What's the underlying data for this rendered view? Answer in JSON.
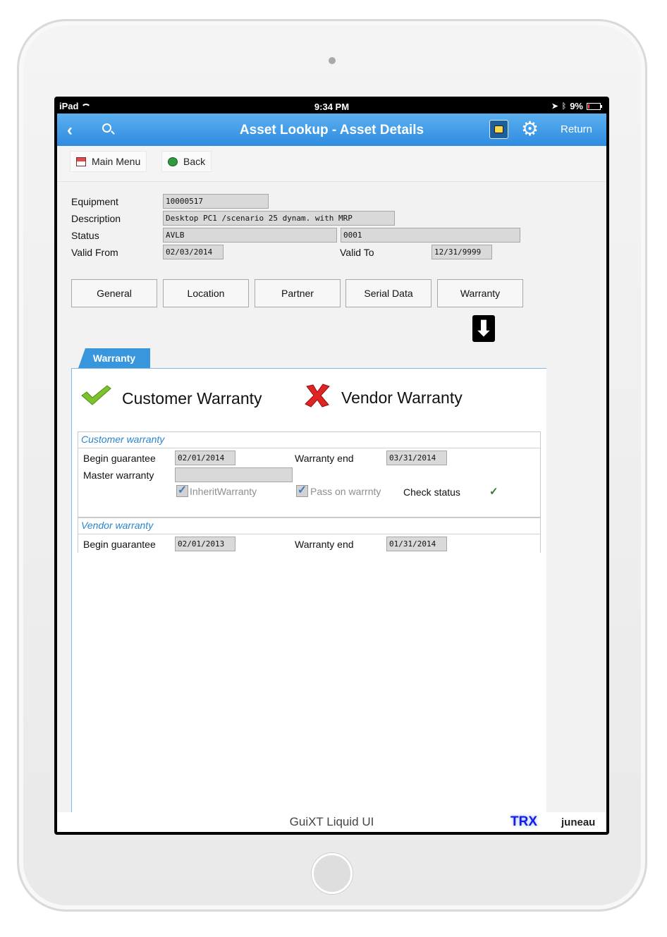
{
  "status_bar": {
    "device": "iPad",
    "time": "9:34 PM",
    "battery": "9%"
  },
  "nav": {
    "title": "Asset Lookup - Asset Details",
    "back_glyph": "‹",
    "return_label": "Return"
  },
  "toolbar": {
    "main_menu_label": "Main Menu",
    "back_label": "Back"
  },
  "header_fields": {
    "equipment_label": "Equipment",
    "equipment_value": "10000517",
    "description_label": "Description",
    "description_value": "Desktop PC1 /scenario 25 dynam. with MRP",
    "status_label": "Status",
    "status_value": "AVLB",
    "status_code": "0001",
    "valid_from_label": "Valid From",
    "valid_from_value": "02/03/2014",
    "valid_to_label": "Valid To",
    "valid_to_value": "12/31/9999"
  },
  "tabs": [
    "General",
    "Location",
    "Partner",
    "Serial Data",
    "Warranty"
  ],
  "active_tab_label": "Warranty",
  "warranty_status": {
    "customer_heading": "Customer Warranty",
    "vendor_heading": "Vendor Warranty"
  },
  "customer_group": {
    "title": "Customer warranty",
    "begin_label": "Begin guarantee",
    "begin_value": "02/01/2014",
    "end_label": "Warranty end",
    "end_value": "03/31/2014",
    "master_label": "Master warranty",
    "master_value": "",
    "inherit_label": "InheritWarranty",
    "pass_on_label": "Pass on warrnty",
    "check_status_label": "Check status"
  },
  "vendor_group": {
    "title": "Vendor warranty",
    "begin_label": "Begin guarantee",
    "begin_value": "02/01/2013",
    "end_label": "Warranty end",
    "end_value": "01/31/2014"
  },
  "footer": {
    "product": "GuiXT Liquid UI",
    "trx": "TRX",
    "user": "juneau"
  },
  "colors": {
    "nav_blue": "#2e8be0",
    "tab_blue": "#3796dc",
    "group_title": "#2b84cc",
    "trx": "#1a1ae6"
  }
}
